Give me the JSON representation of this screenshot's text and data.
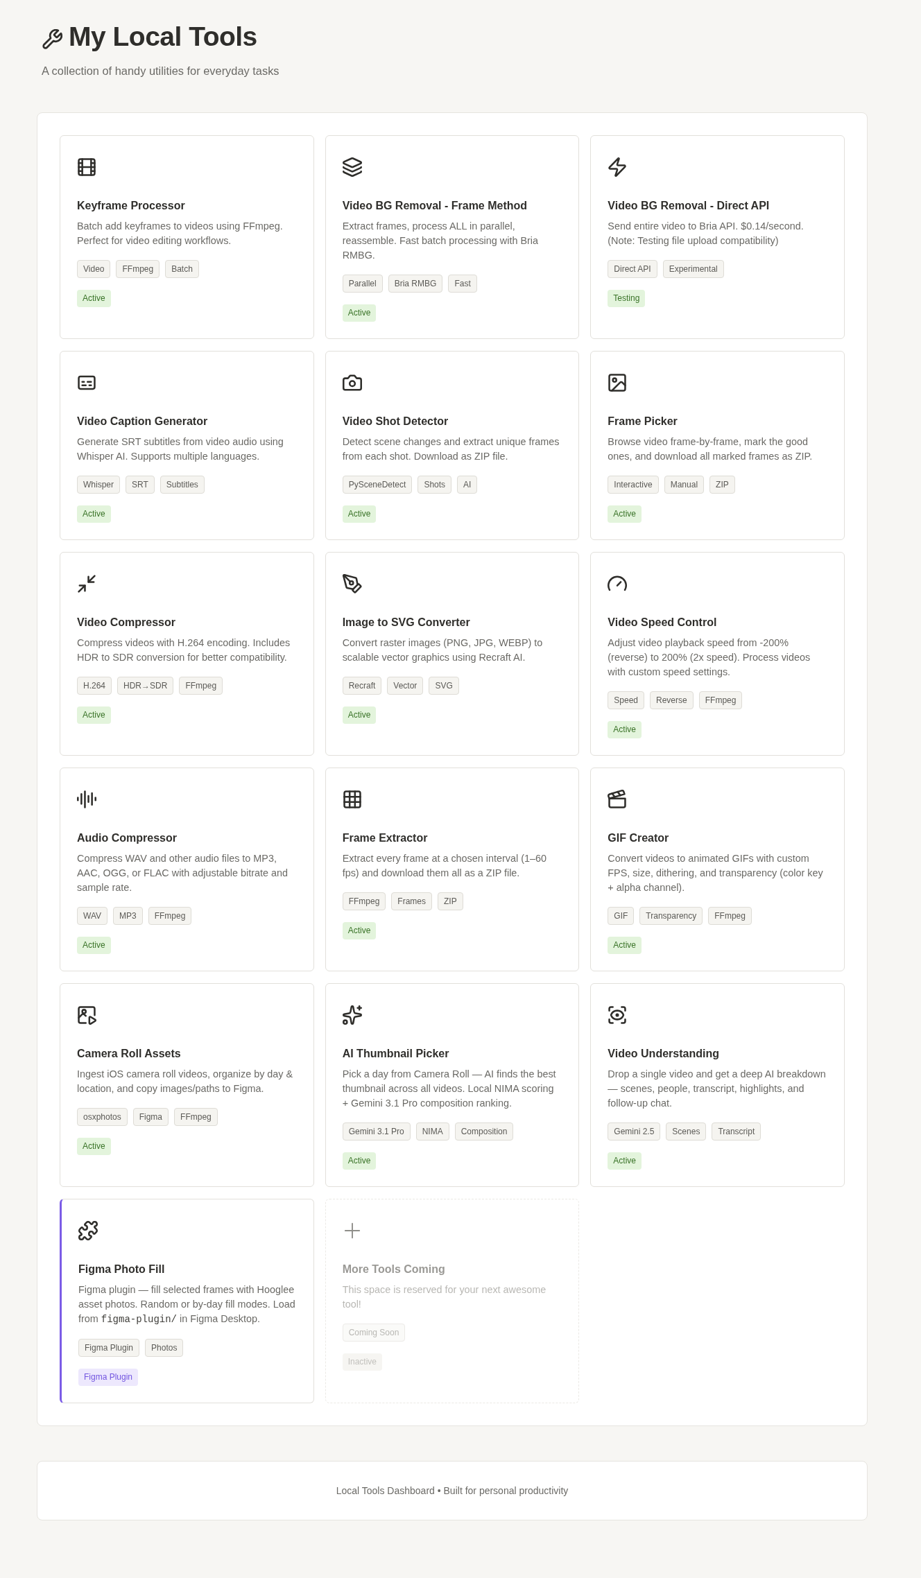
{
  "header": {
    "title": "My Local Tools",
    "subtitle": "A collection of handy utilities for everyday tasks"
  },
  "tools": [
    {
      "kind": "tool",
      "title": "Keyframe Processor",
      "description": "Batch add keyframes to videos using FFmpeg. Perfect for video editing workflows.",
      "tags": [
        "Video",
        "FFmpeg",
        "Batch"
      ],
      "status": {
        "label": "Active",
        "kind": "ok"
      }
    },
    {
      "kind": "tool",
      "title": "Video BG Removal - Frame Method",
      "description": "Extract frames, process ALL in parallel, reassemble. Fast batch processing with Bria RMBG.",
      "tags": [
        "Parallel",
        "Bria RMBG",
        "Fast"
      ],
      "status": {
        "label": "Active",
        "kind": "ok"
      }
    },
    {
      "kind": "tool",
      "title": "Video BG Removal - Direct API",
      "description": "Send entire video to Bria API. $0.14/second. (Note: Testing file upload compatibility)",
      "tags": [
        "Direct API",
        "Experimental"
      ],
      "status": {
        "label": "Testing",
        "kind": "ok"
      }
    },
    {
      "kind": "tool",
      "title": "Video Caption Generator",
      "description": "Generate SRT subtitles from video audio using Whisper AI. Supports multiple languages.",
      "tags": [
        "Whisper",
        "SRT",
        "Subtitles"
      ],
      "status": {
        "label": "Active",
        "kind": "ok"
      }
    },
    {
      "kind": "tool",
      "title": "Video Shot Detector",
      "description": "Detect scene changes and extract unique frames from each shot. Download as ZIP file.",
      "tags": [
        "PySceneDetect",
        "Shots",
        "AI"
      ],
      "status": {
        "label": "Active",
        "kind": "ok"
      }
    },
    {
      "kind": "tool",
      "title": "Frame Picker",
      "description": "Browse video frame-by-frame, mark the good ones, and download all marked frames as ZIP.",
      "tags": [
        "Interactive",
        "Manual",
        "ZIP"
      ],
      "status": {
        "label": "Active",
        "kind": "ok"
      }
    },
    {
      "kind": "tool",
      "title": "Video Compressor",
      "description": "Compress videos with H.264 encoding. Includes HDR to SDR conversion for better compatibility.",
      "tags": [
        "H.264",
        "HDR→SDR",
        "FFmpeg"
      ],
      "status": {
        "label": "Active",
        "kind": "ok"
      }
    },
    {
      "kind": "tool",
      "title": "Image to SVG Converter",
      "description": "Convert raster images (PNG, JPG, WEBP) to scalable vector graphics using Recraft AI.",
      "tags": [
        "Recraft",
        "Vector",
        "SVG"
      ],
      "status": {
        "label": "Active",
        "kind": "ok"
      }
    },
    {
      "kind": "tool",
      "title": "Video Speed Control",
      "description": "Adjust video playback speed from -200% (reverse) to 200% (2x speed). Process videos with custom speed settings.",
      "tags": [
        "Speed",
        "Reverse",
        "FFmpeg"
      ],
      "status": {
        "label": "Active",
        "kind": "ok"
      }
    },
    {
      "kind": "tool",
      "title": "Audio Compressor",
      "description": "Compress WAV and other audio files to MP3, AAC, OGG, or FLAC with adjustable bitrate and sample rate.",
      "tags": [
        "WAV",
        "MP3",
        "FFmpeg"
      ],
      "status": {
        "label": "Active",
        "kind": "ok"
      }
    },
    {
      "kind": "tool",
      "title": "Frame Extractor",
      "description": "Extract every frame at a chosen interval (1–60 fps) and download them all as a ZIP file.",
      "tags": [
        "FFmpeg",
        "Frames",
        "ZIP"
      ],
      "status": {
        "label": "Active",
        "kind": "ok"
      }
    },
    {
      "kind": "tool",
      "title": "GIF Creator",
      "description": "Convert videos to animated GIFs with custom FPS, size, dithering, and transparency (color key + alpha channel).",
      "tags": [
        "GIF",
        "Transparency",
        "FFmpeg"
      ],
      "status": {
        "label": "Active",
        "kind": "ok"
      }
    },
    {
      "kind": "tool",
      "title": "Camera Roll Assets",
      "description": "Ingest iOS camera roll videos, organize by day & location, and copy images/paths to Figma.",
      "tags": [
        "osxphotos",
        "Figma",
        "FFmpeg"
      ],
      "status": {
        "label": "Active",
        "kind": "ok"
      }
    },
    {
      "kind": "tool",
      "title": "AI Thumbnail Picker",
      "description": "Pick a day from Camera Roll — AI finds the best thumbnail across all videos. Local NIMA scoring + Gemini 3.1 Pro composition ranking.",
      "tags": [
        "Gemini 3.1 Pro",
        "NIMA",
        "Composition"
      ],
      "status": {
        "label": "Active",
        "kind": "ok"
      }
    },
    {
      "kind": "tool",
      "title": "Video Understanding",
      "description": "Drop a single video and get a deep AI breakdown — scenes, people, transcript, highlights, and follow-up chat.",
      "tags": [
        "Gemini 2.5",
        "Scenes",
        "Transcript"
      ],
      "status": {
        "label": "Active",
        "kind": "ok"
      }
    },
    {
      "kind": "plugin",
      "title": "Figma Photo Fill",
      "description": [
        {
          "text": "Figma plugin — fill selected frames with Hooglee asset photos. Random or by-day fill modes. Load from ",
          "kind": "text"
        },
        {
          "text": "figma-plugin/",
          "kind": "code"
        },
        {
          "text": " in Figma Desktop.",
          "kind": "text"
        }
      ],
      "tags": [
        "Figma Plugin",
        "Photos"
      ],
      "status": {
        "label": "Figma Plugin",
        "kind": "plugin"
      }
    },
    {
      "kind": "placeholder",
      "title": "More Tools Coming",
      "description": "This space is reserved for your next awesome tool!",
      "tags": [
        "Coming Soon"
      ],
      "status": {
        "label": "Inactive",
        "kind": "inactive"
      }
    }
  ],
  "footer": {
    "text": "Local Tools Dashboard • Built for personal productivity"
  }
}
